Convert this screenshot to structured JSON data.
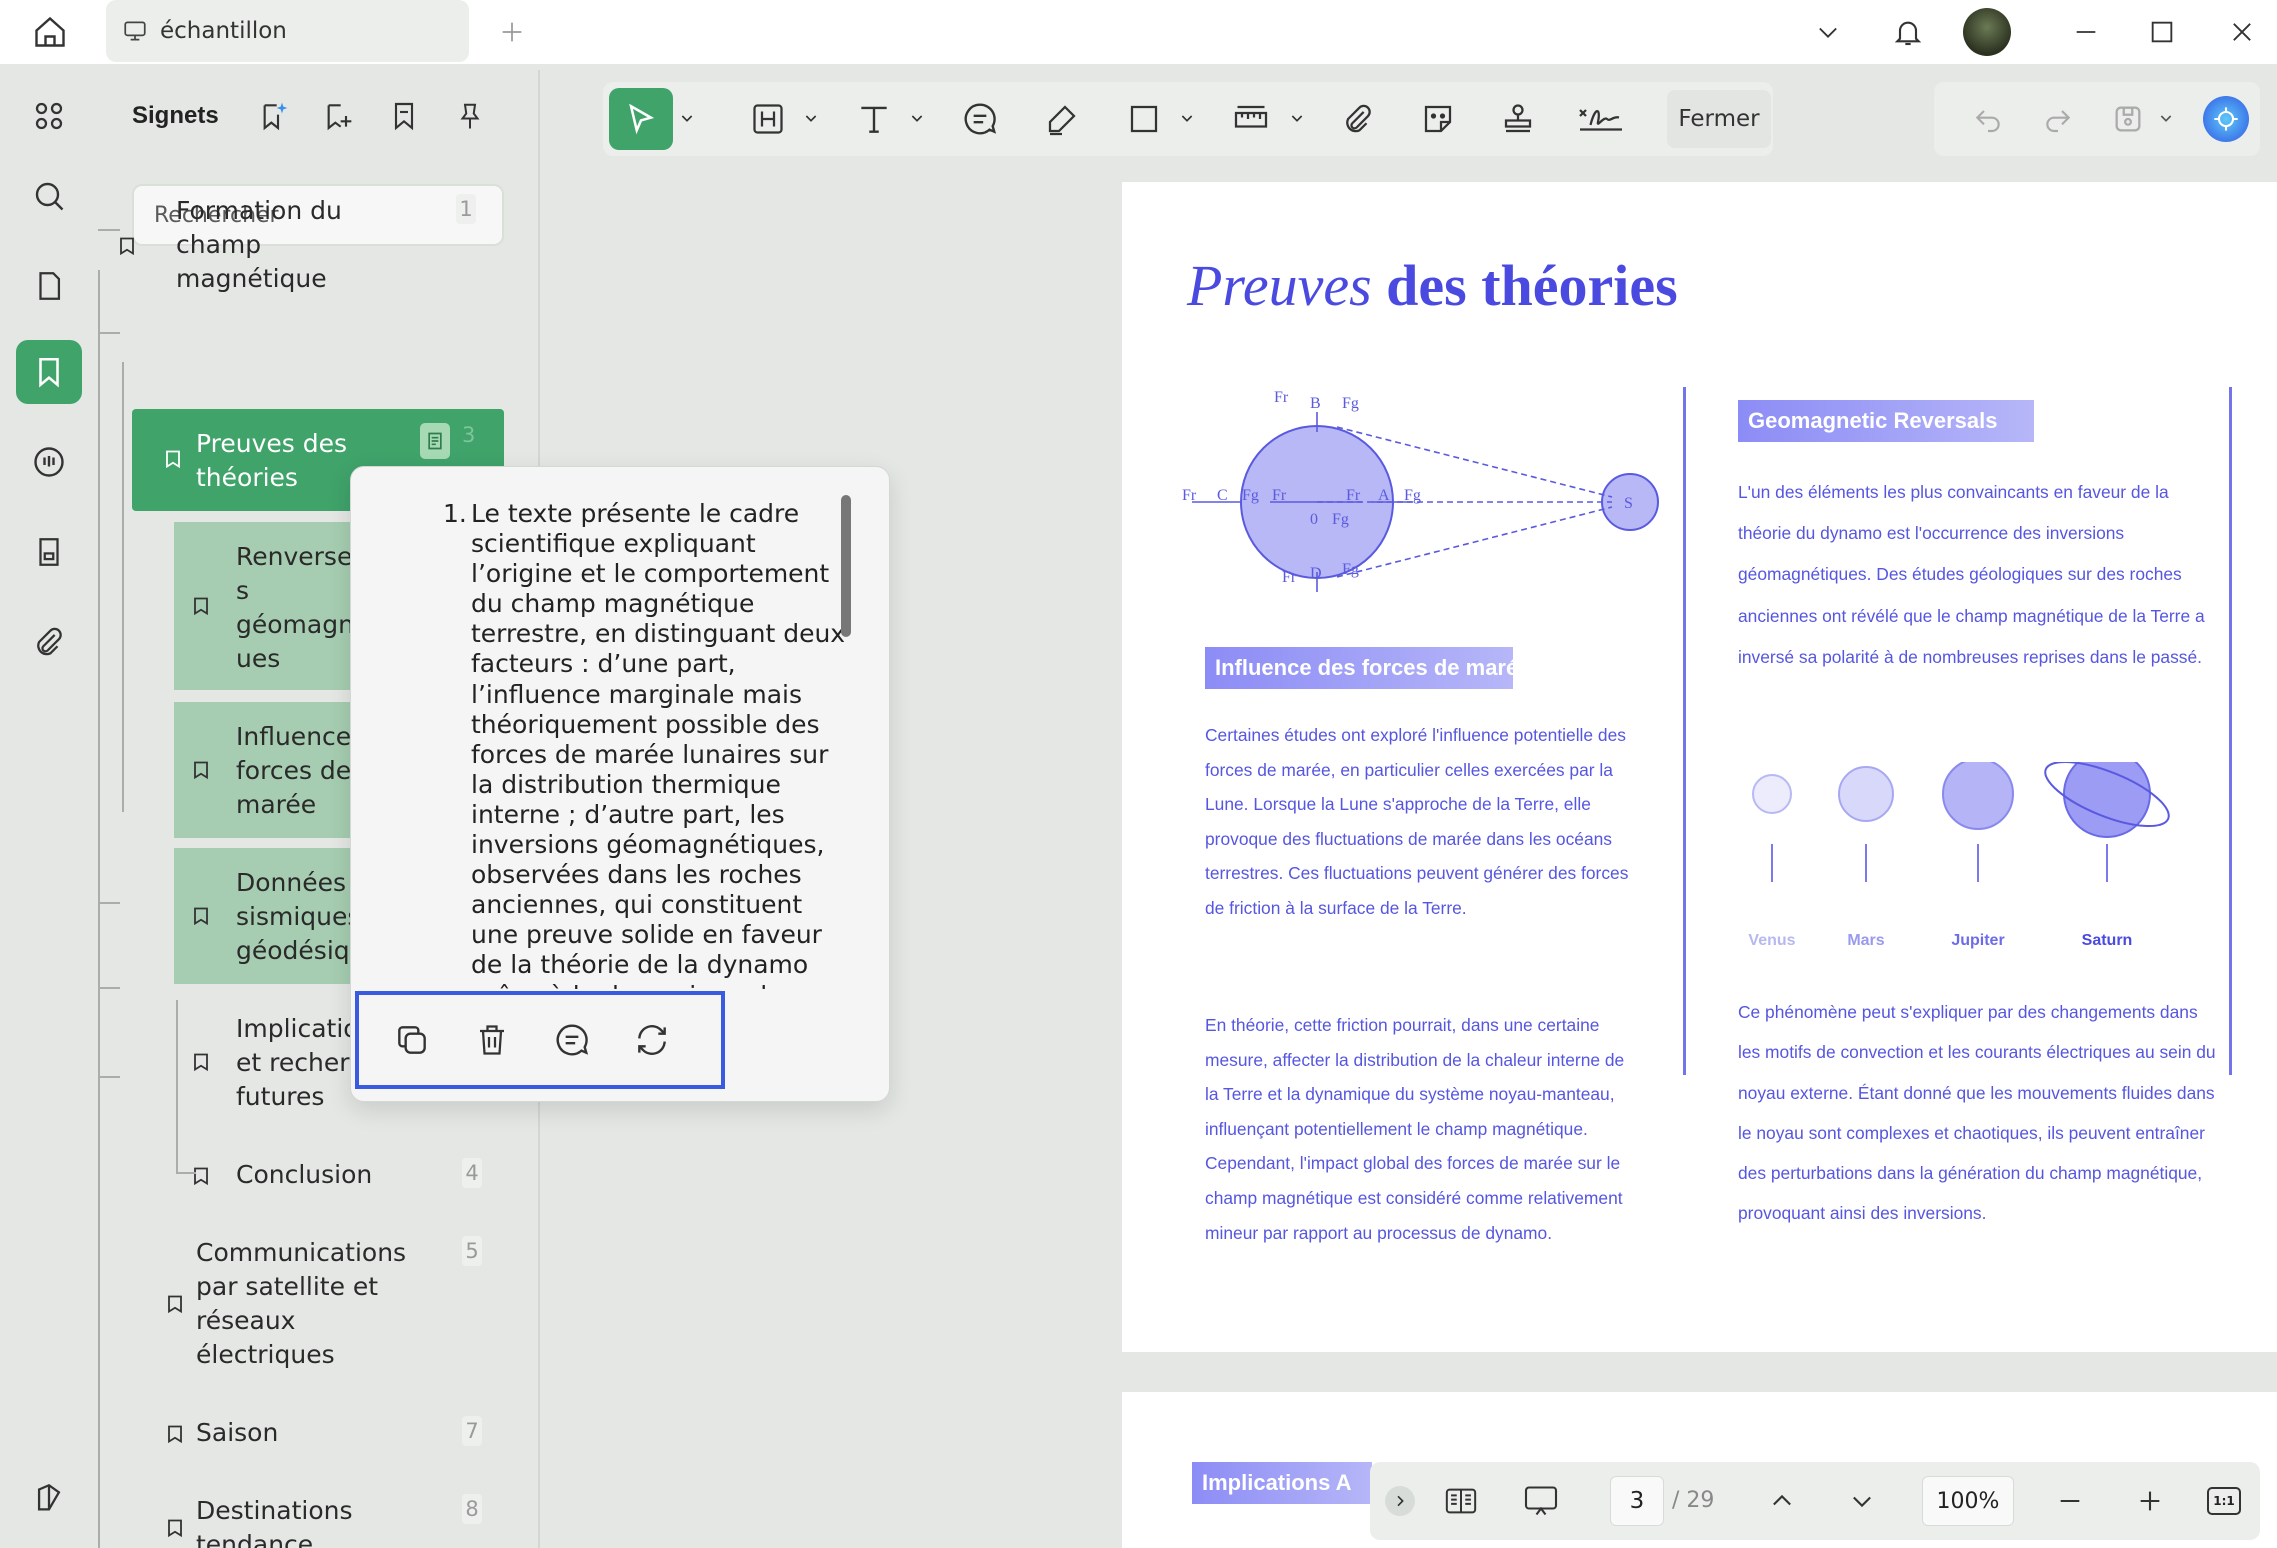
{
  "tab": {
    "title": "échantillon"
  },
  "panel": {
    "title": "Signets",
    "search_placeholder": "Rechercher"
  },
  "bookmarks": [
    {
      "lines": [
        "Formation du",
        "champ",
        "magnétique"
      ],
      "page": "1"
    },
    {
      "lines": [
        "Preuves des",
        "théories"
      ],
      "page": "3"
    },
    {
      "lines": [
        "Renverser",
        "s",
        "géomagn",
        "ues"
      ]
    },
    {
      "lines": [
        "Influence",
        "forces de",
        "marée"
      ]
    },
    {
      "lines": [
        "Données",
        "sismiques",
        "géodésiq"
      ]
    },
    {
      "lines": [
        "Implicatio",
        "et recherc",
        "futures"
      ]
    },
    {
      "lines": [
        "Conclusion"
      ],
      "page": "4"
    },
    {
      "lines": [
        "Communications",
        "par satellite et",
        "réseaux",
        "électriques"
      ],
      "page": "5"
    },
    {
      "lines": [
        "Saison"
      ],
      "page": "7"
    },
    {
      "lines": [
        "Destinations",
        "tendance"
      ],
      "page": "8"
    }
  ],
  "popup": {
    "number": "1.",
    "text": "Le texte présente le cadre scientifique expliquant l’origine et le comportement du champ magnétique terrestre, en distinguant deux facteurs : d’une part, l’influence marginale mais théoriquement possible des forces de marée lunaires sur la distribution thermique interne ; d’autre part, les inversions géomagnétiques, observées dans les roches anciennes, qui constituent une preuve solide en faveur de la théorie de la dynamo grâce à la dynamique du noyau externe."
  },
  "toolbar": {
    "close_label": "Fermer"
  },
  "document": {
    "title_italic": "Preuves",
    "title_bold": "des théories",
    "diagram_labels": {
      "fr": "Fr",
      "fg": "Fg",
      "b": "B",
      "c": "C",
      "d": "D",
      "a": "A",
      "zero": "0",
      "s": "S"
    },
    "section1_head": "Influence des forces de marée",
    "section1_p1": "Certaines études ont exploré l'influence potentielle des forces de marée, en particulier celles exercées par la Lune. Lorsque la Lune s'approche de la Terre, elle provoque des fluctuations de marée dans les océans terrestres. Ces fluctuations peuvent générer des forces de friction à la surface de la Terre.",
    "section1_p2": "En théorie, cette friction pourrait, dans une certaine mesure, affecter la distribution de la chaleur interne de la Terre et la dynamique du système noyau-manteau, influençant potentiellement le champ magnétique. Cependant, l'impact global des forces de marée sur le champ magnétique est considéré comme relativement mineur par rapport au processus de dynamo.",
    "section2_head": "Geomagnetic Reversals",
    "section2_p1": "L'un des éléments les plus convaincants en faveur de la théorie du dynamo est l'occurrence des inversions géomagnétiques. Des études géologiques sur des roches anciennes ont révélé que le champ magnétique de la Terre a inversé sa polarité à de nombreuses reprises dans le passé.",
    "section2_p2": "Ce phénomène peut s'expliquer par des changements dans les motifs de convection et les courants électriques au sein du noyau externe. Étant donné que les mouvements fluides dans le noyau sont complexes et chaotiques, ils peuvent entraîner des perturbations dans la génération du champ magnétique, provoquant ainsi des inversions.",
    "planets": [
      "Venus",
      "Mars",
      "Jupiter",
      "Saturn"
    ],
    "page2_head": "Implications A"
  },
  "statusbar": {
    "current_page": "3",
    "total": "/ 29",
    "zoom": "100%",
    "fit_label": "1:1"
  },
  "colors": {
    "accent_green": "#3fa36a",
    "doc_blue": "#4a4ae0",
    "highlight_border": "#3a5be0"
  }
}
